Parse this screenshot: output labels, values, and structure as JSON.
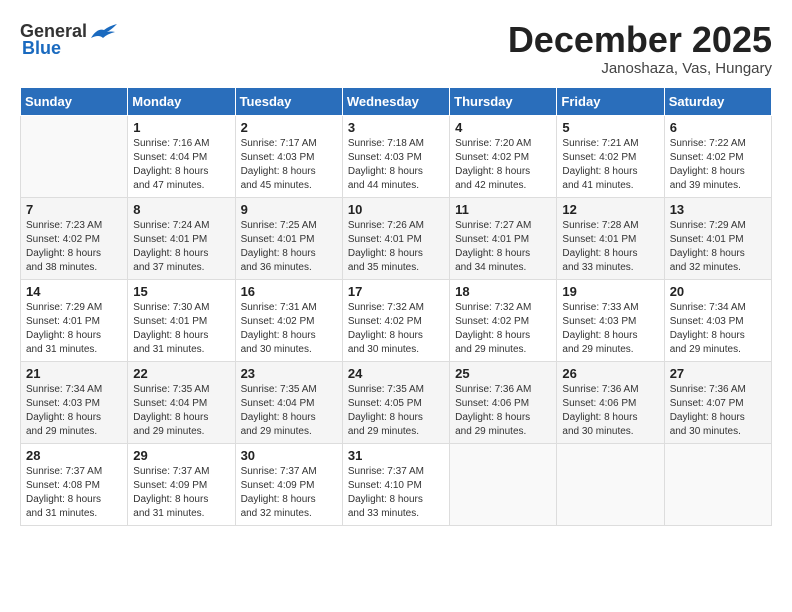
{
  "header": {
    "logo_general": "General",
    "logo_blue": "Blue",
    "month": "December 2025",
    "location": "Janoshaza, Vas, Hungary"
  },
  "weekdays": [
    "Sunday",
    "Monday",
    "Tuesday",
    "Wednesday",
    "Thursday",
    "Friday",
    "Saturday"
  ],
  "weeks": [
    [
      {
        "day": "",
        "info": ""
      },
      {
        "day": "1",
        "info": "Sunrise: 7:16 AM\nSunset: 4:04 PM\nDaylight: 8 hours\nand 47 minutes."
      },
      {
        "day": "2",
        "info": "Sunrise: 7:17 AM\nSunset: 4:03 PM\nDaylight: 8 hours\nand 45 minutes."
      },
      {
        "day": "3",
        "info": "Sunrise: 7:18 AM\nSunset: 4:03 PM\nDaylight: 8 hours\nand 44 minutes."
      },
      {
        "day": "4",
        "info": "Sunrise: 7:20 AM\nSunset: 4:02 PM\nDaylight: 8 hours\nand 42 minutes."
      },
      {
        "day": "5",
        "info": "Sunrise: 7:21 AM\nSunset: 4:02 PM\nDaylight: 8 hours\nand 41 minutes."
      },
      {
        "day": "6",
        "info": "Sunrise: 7:22 AM\nSunset: 4:02 PM\nDaylight: 8 hours\nand 39 minutes."
      }
    ],
    [
      {
        "day": "7",
        "info": "Sunrise: 7:23 AM\nSunset: 4:02 PM\nDaylight: 8 hours\nand 38 minutes."
      },
      {
        "day": "8",
        "info": "Sunrise: 7:24 AM\nSunset: 4:01 PM\nDaylight: 8 hours\nand 37 minutes."
      },
      {
        "day": "9",
        "info": "Sunrise: 7:25 AM\nSunset: 4:01 PM\nDaylight: 8 hours\nand 36 minutes."
      },
      {
        "day": "10",
        "info": "Sunrise: 7:26 AM\nSunset: 4:01 PM\nDaylight: 8 hours\nand 35 minutes."
      },
      {
        "day": "11",
        "info": "Sunrise: 7:27 AM\nSunset: 4:01 PM\nDaylight: 8 hours\nand 34 minutes."
      },
      {
        "day": "12",
        "info": "Sunrise: 7:28 AM\nSunset: 4:01 PM\nDaylight: 8 hours\nand 33 minutes."
      },
      {
        "day": "13",
        "info": "Sunrise: 7:29 AM\nSunset: 4:01 PM\nDaylight: 8 hours\nand 32 minutes."
      }
    ],
    [
      {
        "day": "14",
        "info": "Sunrise: 7:29 AM\nSunset: 4:01 PM\nDaylight: 8 hours\nand 31 minutes."
      },
      {
        "day": "15",
        "info": "Sunrise: 7:30 AM\nSunset: 4:01 PM\nDaylight: 8 hours\nand 31 minutes."
      },
      {
        "day": "16",
        "info": "Sunrise: 7:31 AM\nSunset: 4:02 PM\nDaylight: 8 hours\nand 30 minutes."
      },
      {
        "day": "17",
        "info": "Sunrise: 7:32 AM\nSunset: 4:02 PM\nDaylight: 8 hours\nand 30 minutes."
      },
      {
        "day": "18",
        "info": "Sunrise: 7:32 AM\nSunset: 4:02 PM\nDaylight: 8 hours\nand 29 minutes."
      },
      {
        "day": "19",
        "info": "Sunrise: 7:33 AM\nSunset: 4:03 PM\nDaylight: 8 hours\nand 29 minutes."
      },
      {
        "day": "20",
        "info": "Sunrise: 7:34 AM\nSunset: 4:03 PM\nDaylight: 8 hours\nand 29 minutes."
      }
    ],
    [
      {
        "day": "21",
        "info": "Sunrise: 7:34 AM\nSunset: 4:03 PM\nDaylight: 8 hours\nand 29 minutes."
      },
      {
        "day": "22",
        "info": "Sunrise: 7:35 AM\nSunset: 4:04 PM\nDaylight: 8 hours\nand 29 minutes."
      },
      {
        "day": "23",
        "info": "Sunrise: 7:35 AM\nSunset: 4:04 PM\nDaylight: 8 hours\nand 29 minutes."
      },
      {
        "day": "24",
        "info": "Sunrise: 7:35 AM\nSunset: 4:05 PM\nDaylight: 8 hours\nand 29 minutes."
      },
      {
        "day": "25",
        "info": "Sunrise: 7:36 AM\nSunset: 4:06 PM\nDaylight: 8 hours\nand 29 minutes."
      },
      {
        "day": "26",
        "info": "Sunrise: 7:36 AM\nSunset: 4:06 PM\nDaylight: 8 hours\nand 30 minutes."
      },
      {
        "day": "27",
        "info": "Sunrise: 7:36 AM\nSunset: 4:07 PM\nDaylight: 8 hours\nand 30 minutes."
      }
    ],
    [
      {
        "day": "28",
        "info": "Sunrise: 7:37 AM\nSunset: 4:08 PM\nDaylight: 8 hours\nand 31 minutes."
      },
      {
        "day": "29",
        "info": "Sunrise: 7:37 AM\nSunset: 4:09 PM\nDaylight: 8 hours\nand 31 minutes."
      },
      {
        "day": "30",
        "info": "Sunrise: 7:37 AM\nSunset: 4:09 PM\nDaylight: 8 hours\nand 32 minutes."
      },
      {
        "day": "31",
        "info": "Sunrise: 7:37 AM\nSunset: 4:10 PM\nDaylight: 8 hours\nand 33 minutes."
      },
      {
        "day": "",
        "info": ""
      },
      {
        "day": "",
        "info": ""
      },
      {
        "day": "",
        "info": ""
      }
    ]
  ]
}
